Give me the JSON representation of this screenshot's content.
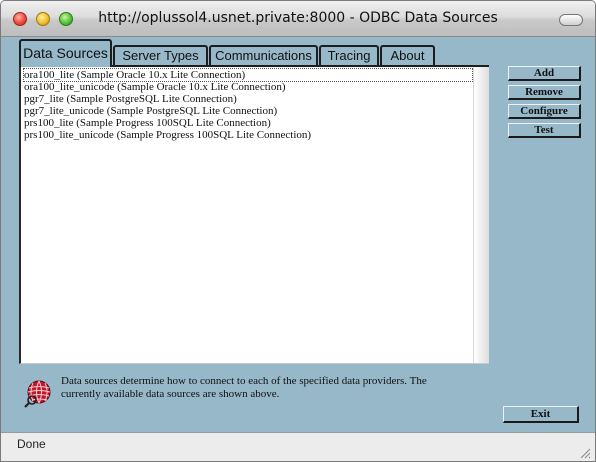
{
  "window": {
    "title": "http://oplussol4.usnet.private:8000 - ODBC Data Sources"
  },
  "tabs": [
    {
      "label": "Data Sources",
      "active": true
    },
    {
      "label": "Server Types"
    },
    {
      "label": "Communications"
    },
    {
      "label": "Tracing"
    },
    {
      "label": "About"
    }
  ],
  "data_sources": [
    "ora100_lite (Sample Oracle 10.x Lite Connection)",
    "ora100_lite_unicode (Sample Oracle 10.x Lite Connection)",
    "pgr7_lite (Sample PostgreSQL Lite Connection)",
    "pgr7_lite_unicode (Sample PostgreSQL Lite Connection)",
    "prs100_lite (Sample Progress 100SQL Lite Connection)",
    "prs100_lite_unicode (Sample Progress 100SQL Lite Connection)"
  ],
  "selected_index": 0,
  "buttons": {
    "add": "Add",
    "remove": "Remove",
    "configure": "Configure",
    "test": "Test",
    "exit": "Exit"
  },
  "info": {
    "line1": "Data sources determine how to connect to each of the specified data providers. The",
    "line2": "currently available data sources are shown above."
  },
  "status": {
    "text": "Done"
  }
}
